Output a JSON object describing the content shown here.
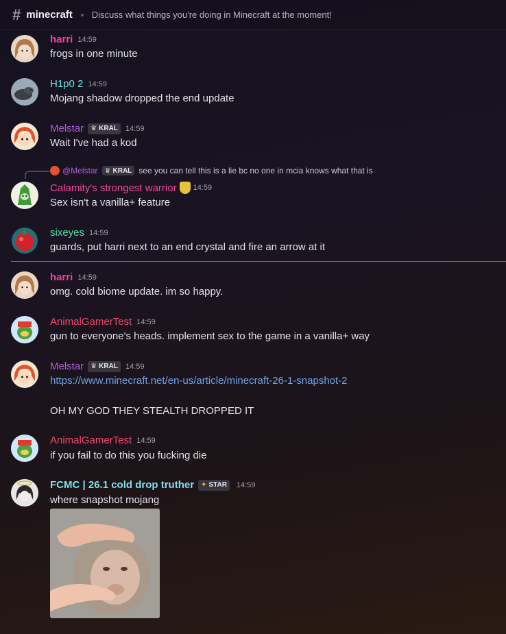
{
  "channel": {
    "name": "minecraft",
    "topic": "Discuss what things you're doing in Minecraft at the moment!"
  },
  "messages": [
    {
      "author": "harri",
      "time": "14:59",
      "text": "frogs in one minute",
      "name_color": "#f5419e"
    },
    {
      "author": "H1p0 2",
      "time": "14:59",
      "text": "Mojang shadow dropped the end update",
      "name_color": "#6ee0e8"
    },
    {
      "author": "Melstar",
      "tag": "KRAL",
      "time": "14:59",
      "text": "Wait I've had a kod",
      "name_color": "#b25fd8"
    },
    {
      "reply": {
        "author": "@Melstar",
        "tag": "KRAL",
        "text": "see you can tell this is a lie bc no one in mcia knows what that is"
      },
      "author": "Calamity's strongest warrior",
      "time": "14:59",
      "text": "Sex isn't a vanilla+ feature",
      "name_color": "#f04a9c"
    },
    {
      "author": "sixeyes",
      "time": "14:59",
      "text": "guards, put harri next to an end crystal and fire an arrow at it",
      "name_color": "#4fe39f"
    },
    {
      "author": "harri",
      "time": "14:59",
      "text": "omg. cold biome update. im so happy.",
      "name_color": "#f5419e"
    },
    {
      "author": "AnimalGamerTest",
      "time": "14:59",
      "text": "gun to everyone's heads. implement sex to the game in a vanilla+ way",
      "name_color": "#ef4b6e"
    },
    {
      "author": "Melstar",
      "tag": "KRAL",
      "time": "14:59",
      "link": "https://www.minecraft.net/en-us/article/minecraft-26-1-snapshot-2",
      "text": "OH MY GOD THEY STEALTH DROPPED IT",
      "name_color": "#b25fd8"
    },
    {
      "author": "AnimalGamerTest",
      "time": "14:59",
      "text": "if you fail to do this you fucking die",
      "name_color": "#ef4b6e"
    },
    {
      "author": "FCMC | 26.1 cold drop truther",
      "tag": "STAR",
      "time": "14:59",
      "text": "where snapshot mojang",
      "name_color": "#7fe0ea"
    }
  ]
}
